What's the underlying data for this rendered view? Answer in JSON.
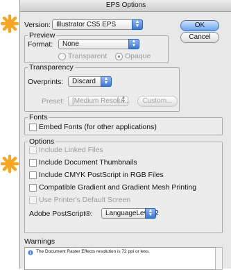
{
  "window": {
    "title": "EPS Options"
  },
  "version": {
    "label": "Version:",
    "value": "Illustrator CS5 EPS"
  },
  "buttons": {
    "ok": "OK",
    "cancel": "Cancel"
  },
  "preview": {
    "title": "Preview",
    "format_label": "Format:",
    "format_value": "None",
    "transparent_label": "Transparent",
    "opaque_label": "Opaque",
    "selected": "opaque"
  },
  "transparency": {
    "title": "Transparency",
    "overprints_label": "Overprints:",
    "overprints_value": "Discard",
    "preset_label": "Preset:",
    "preset_value": "[Medium Resolut...",
    "custom_label": "Custom..."
  },
  "fonts": {
    "title": "Fonts",
    "embed_label": "Embed Fonts (for other applications)",
    "embed_checked": false
  },
  "options": {
    "title": "Options",
    "items": [
      {
        "label": "Include Linked Files",
        "enabled": false,
        "checked": false
      },
      {
        "label": "Include Document Thumbnails",
        "enabled": true,
        "checked": false
      },
      {
        "label": "Include CMYK PostScript in RGB Files",
        "enabled": true,
        "checked": false
      },
      {
        "label": "Compatible Gradient and Gradient Mesh Printing",
        "enabled": true,
        "checked": false
      },
      {
        "label": "Use Printer's Default Screen",
        "enabled": false,
        "checked": false
      }
    ],
    "postscript_label": "Adobe PostScript®:",
    "postscript_value": "LanguageLevel 2"
  },
  "warnings": {
    "title": "Warnings",
    "message": "The Document Raster Effects resolution is 72 ppi or less."
  },
  "colors": {
    "star": "#f5a623",
    "accent": "#3d78d6"
  },
  "icons": {
    "star": "orange-star-marker-icon",
    "info": "info-icon"
  }
}
